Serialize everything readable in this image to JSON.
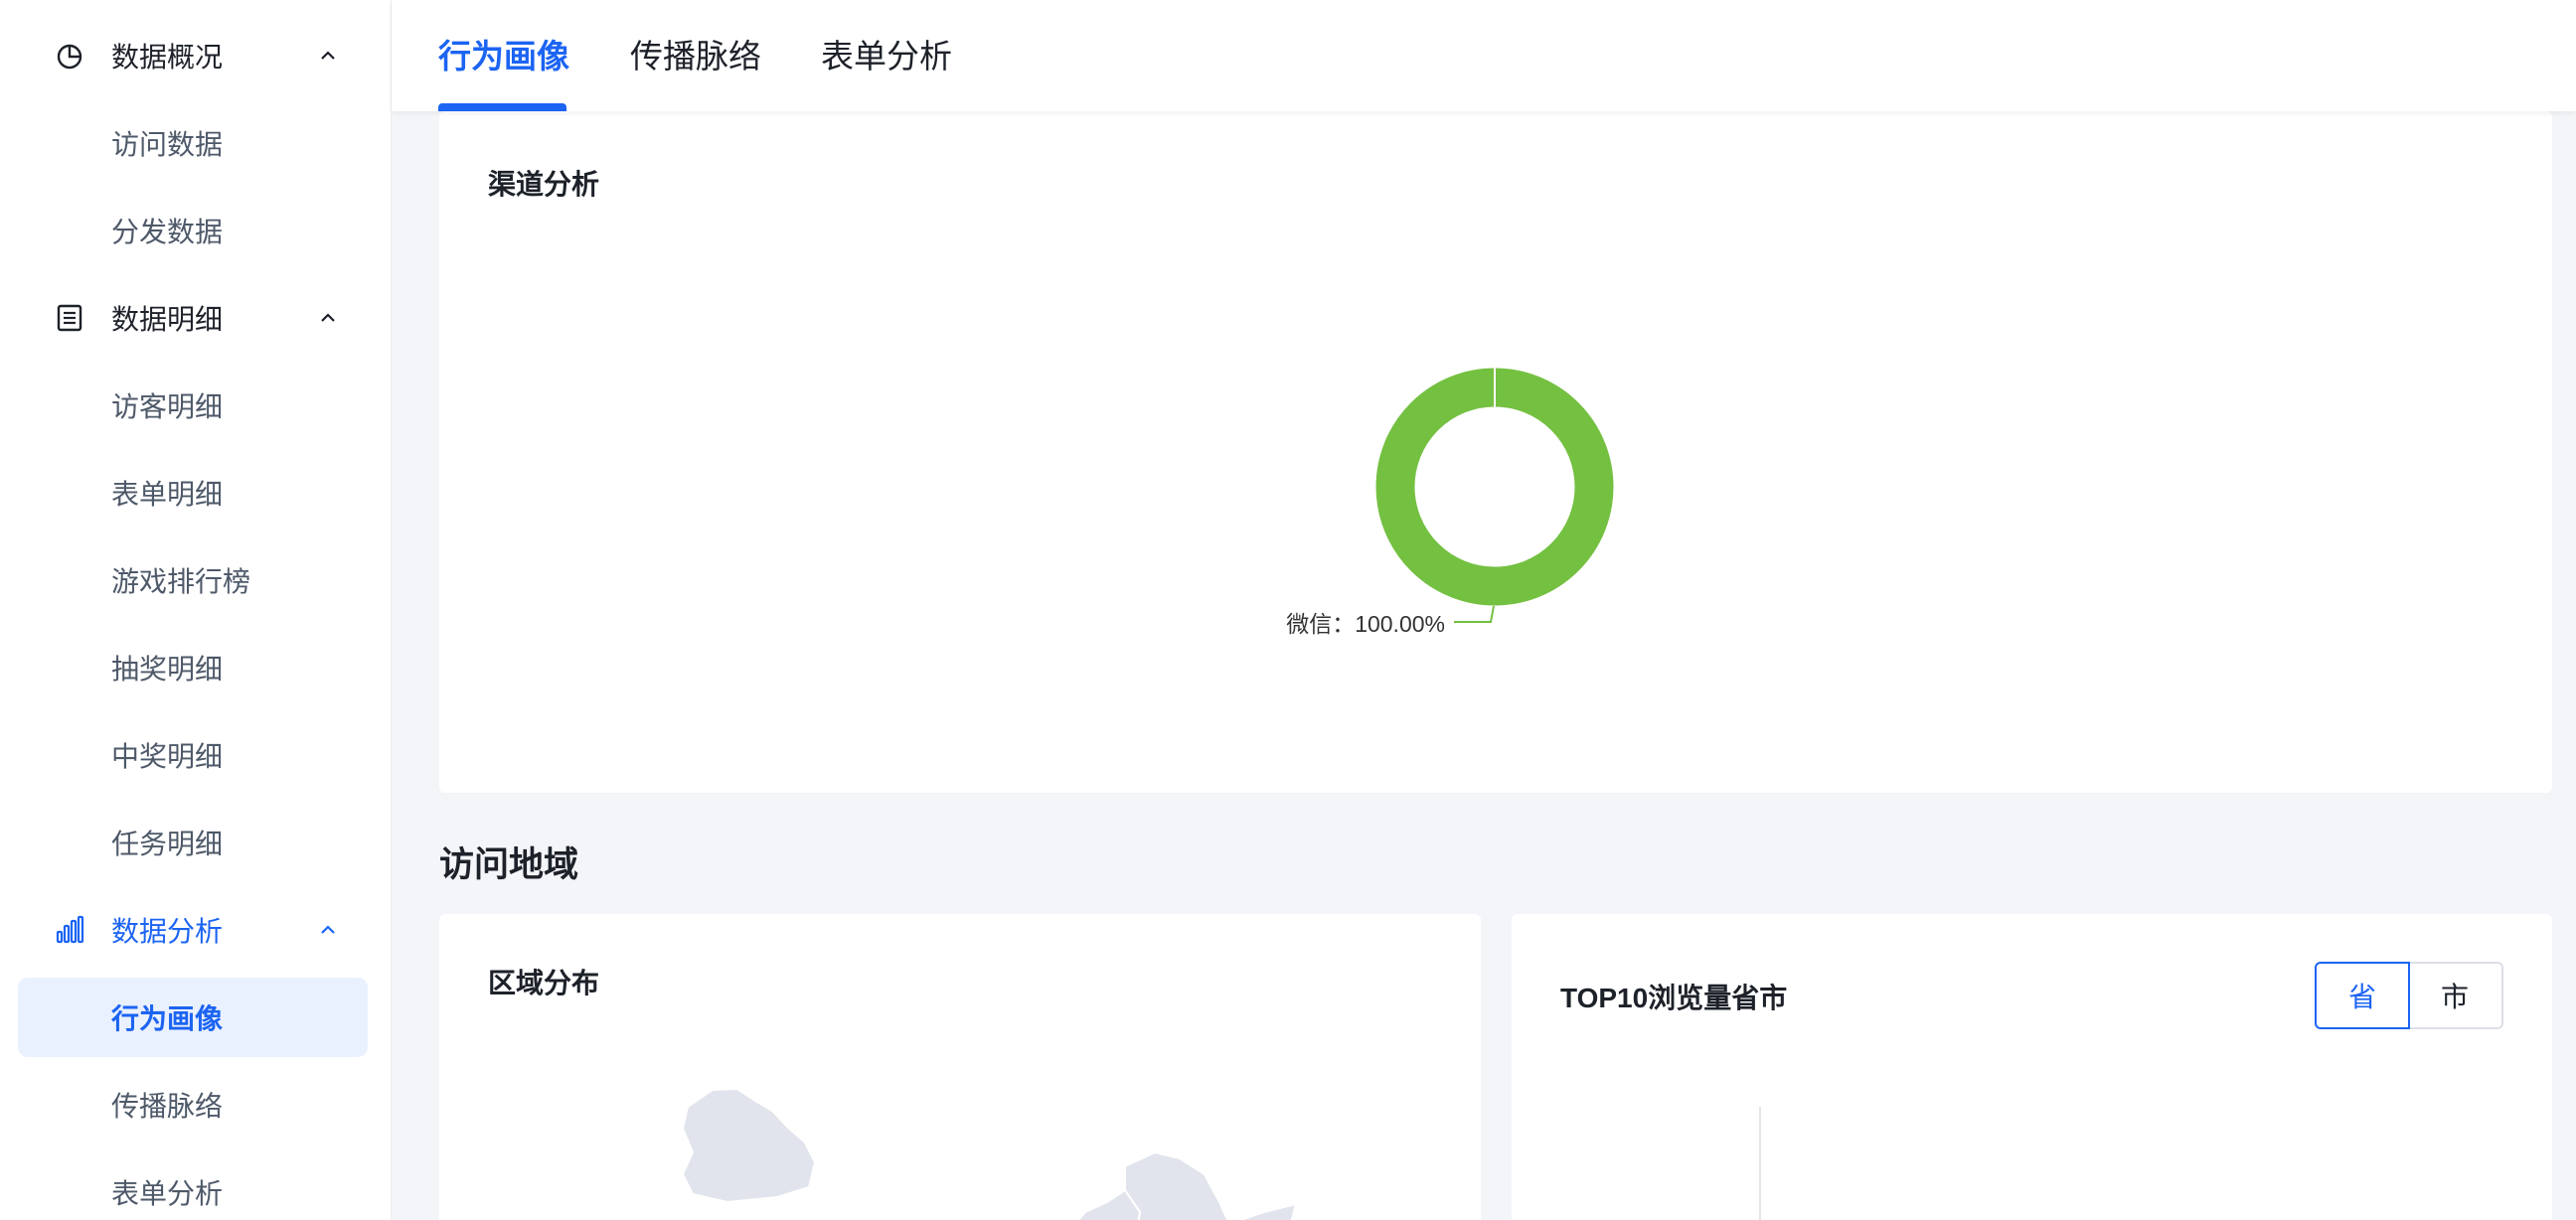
{
  "sidebar": {
    "groups": [
      {
        "label": "数据概况",
        "icon": "pie-chart-icon"
      },
      {
        "label": "数据明细",
        "icon": "list-document-icon"
      },
      {
        "label": "数据分析",
        "icon": "bar-chart-icon"
      }
    ],
    "overview_items": [
      "访问数据",
      "分发数据"
    ],
    "detail_items": [
      "访客明细",
      "表单明细",
      "游戏排行榜",
      "抽奖明细",
      "中奖明细",
      "任务明细"
    ],
    "analysis_items": [
      "行为画像",
      "传播脉络",
      "表单分析"
    ]
  },
  "tabs": [
    "行为画像",
    "传播脉络",
    "表单分析"
  ],
  "channel": {
    "title": "渠道分析",
    "label": "微信：100.00%",
    "color": "#74c041"
  },
  "chart_data": {
    "type": "pie",
    "title": "渠道分析",
    "categories": [
      "微信"
    ],
    "values": [
      100.0
    ]
  },
  "region": {
    "section_title": "访问地域",
    "distribution_title": "区域分布",
    "top10_title": "TOP10浏览量省市",
    "toggle_province": "省",
    "toggle_city": "市"
  },
  "colors": {
    "accent": "#1c64f2",
    "selected_bg": "#eaf1fe",
    "map_fill": "#e1e4ec"
  }
}
